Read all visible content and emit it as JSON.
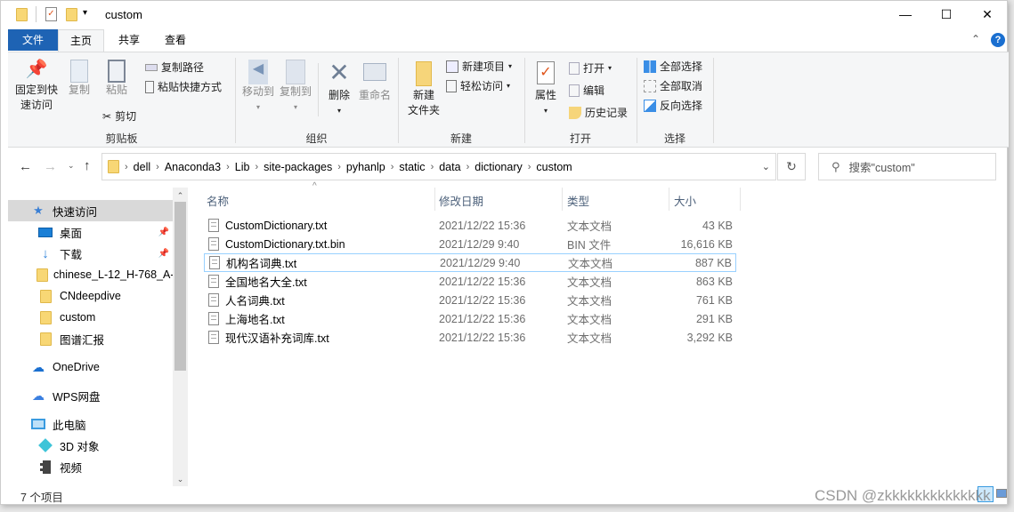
{
  "title_bar": {
    "title": "custom",
    "minimize": "—",
    "maximize": "☐",
    "close": "✕"
  },
  "ribbon": {
    "tabs": [
      {
        "label": "文件"
      },
      {
        "label": "主页"
      },
      {
        "label": "共享"
      },
      {
        "label": "查看"
      }
    ],
    "active_tab": "主页",
    "clipboard": {
      "group": "剪贴板",
      "pin_line1": "固定到快",
      "pin_line2": "速访问",
      "copy": "复制",
      "paste": "粘贴",
      "copy_path": "复制路径",
      "paste_shortcut": "粘贴快捷方式",
      "cut": "剪切"
    },
    "organize": {
      "group": "组织",
      "move_to": "移动到",
      "copy_to": "复制到",
      "delete": "删除",
      "rename": "重命名"
    },
    "new": {
      "group": "新建",
      "new_folder_line1": "新建",
      "new_folder_line2": "文件夹",
      "new_item": "新建项目",
      "easy_access": "轻松访问"
    },
    "open": {
      "group": "打开",
      "properties": "属性",
      "open": "打开",
      "edit": "编辑",
      "history": "历史记录"
    },
    "select": {
      "group": "选择",
      "select_all": "全部选择",
      "select_none": "全部取消",
      "invert": "反向选择"
    }
  },
  "address": {
    "breadcrumbs": [
      "dell",
      "Anaconda3",
      "Lib",
      "site-packages",
      "pyhanlp",
      "static",
      "data",
      "dictionary",
      "custom"
    ]
  },
  "search": {
    "placeholder": "搜索\"custom\""
  },
  "nav": {
    "items": [
      {
        "label": "快速访问",
        "icon": "star-icon"
      },
      {
        "label": "桌面",
        "icon": "desktop-icon",
        "pinned": true
      },
      {
        "label": "下载",
        "icon": "download-icon",
        "pinned": true
      },
      {
        "label": "chinese_L-12_H-768_A-12",
        "icon": "folder-icon"
      },
      {
        "label": "CNdeepdive",
        "icon": "folder-icon"
      },
      {
        "label": "custom",
        "icon": "folder-icon"
      },
      {
        "label": "图谱汇报",
        "icon": "folder-icon"
      },
      {
        "label": "OneDrive",
        "icon": "cloud-icon"
      },
      {
        "label": "WPS网盘",
        "icon": "wps-cloud-icon"
      },
      {
        "label": "此电脑",
        "icon": "computer-icon"
      },
      {
        "label": "3D 对象",
        "icon": "cube-icon"
      },
      {
        "label": "视频",
        "icon": "video-icon"
      }
    ]
  },
  "columns": {
    "name": "名称",
    "date": "修改日期",
    "type": "类型",
    "size": "大小"
  },
  "files": [
    {
      "name": "CustomDictionary.txt",
      "date": "2021/12/22 15:36",
      "type": "文本文档",
      "size": "43 KB"
    },
    {
      "name": "CustomDictionary.txt.bin",
      "date": "2021/12/29 9:40",
      "type": "BIN 文件",
      "size": "16,616 KB"
    },
    {
      "name": "机构名词典.txt",
      "date": "2021/12/29 9:40",
      "type": "文本文档",
      "size": "887 KB"
    },
    {
      "name": "全国地名大全.txt",
      "date": "2021/12/22 15:36",
      "type": "文本文档",
      "size": "863 KB"
    },
    {
      "name": "人名词典.txt",
      "date": "2021/12/22 15:36",
      "type": "文本文档",
      "size": "761 KB"
    },
    {
      "name": "上海地名.txt",
      "date": "2021/12/22 15:36",
      "type": "文本文档",
      "size": "291 KB"
    },
    {
      "name": "现代汉语补充词库.txt",
      "date": "2021/12/22 15:36",
      "type": "文本文档",
      "size": "3,292 KB"
    }
  ],
  "status": {
    "count": "7 个项目"
  },
  "watermark": "CSDN @zkkkkkkkkkkkkkk",
  "colors": {
    "accent": "#1a5fb4",
    "file_tab": "#1e63b4",
    "selection_border": "#99d1ff",
    "nav_selected": "#d9d9d9"
  }
}
